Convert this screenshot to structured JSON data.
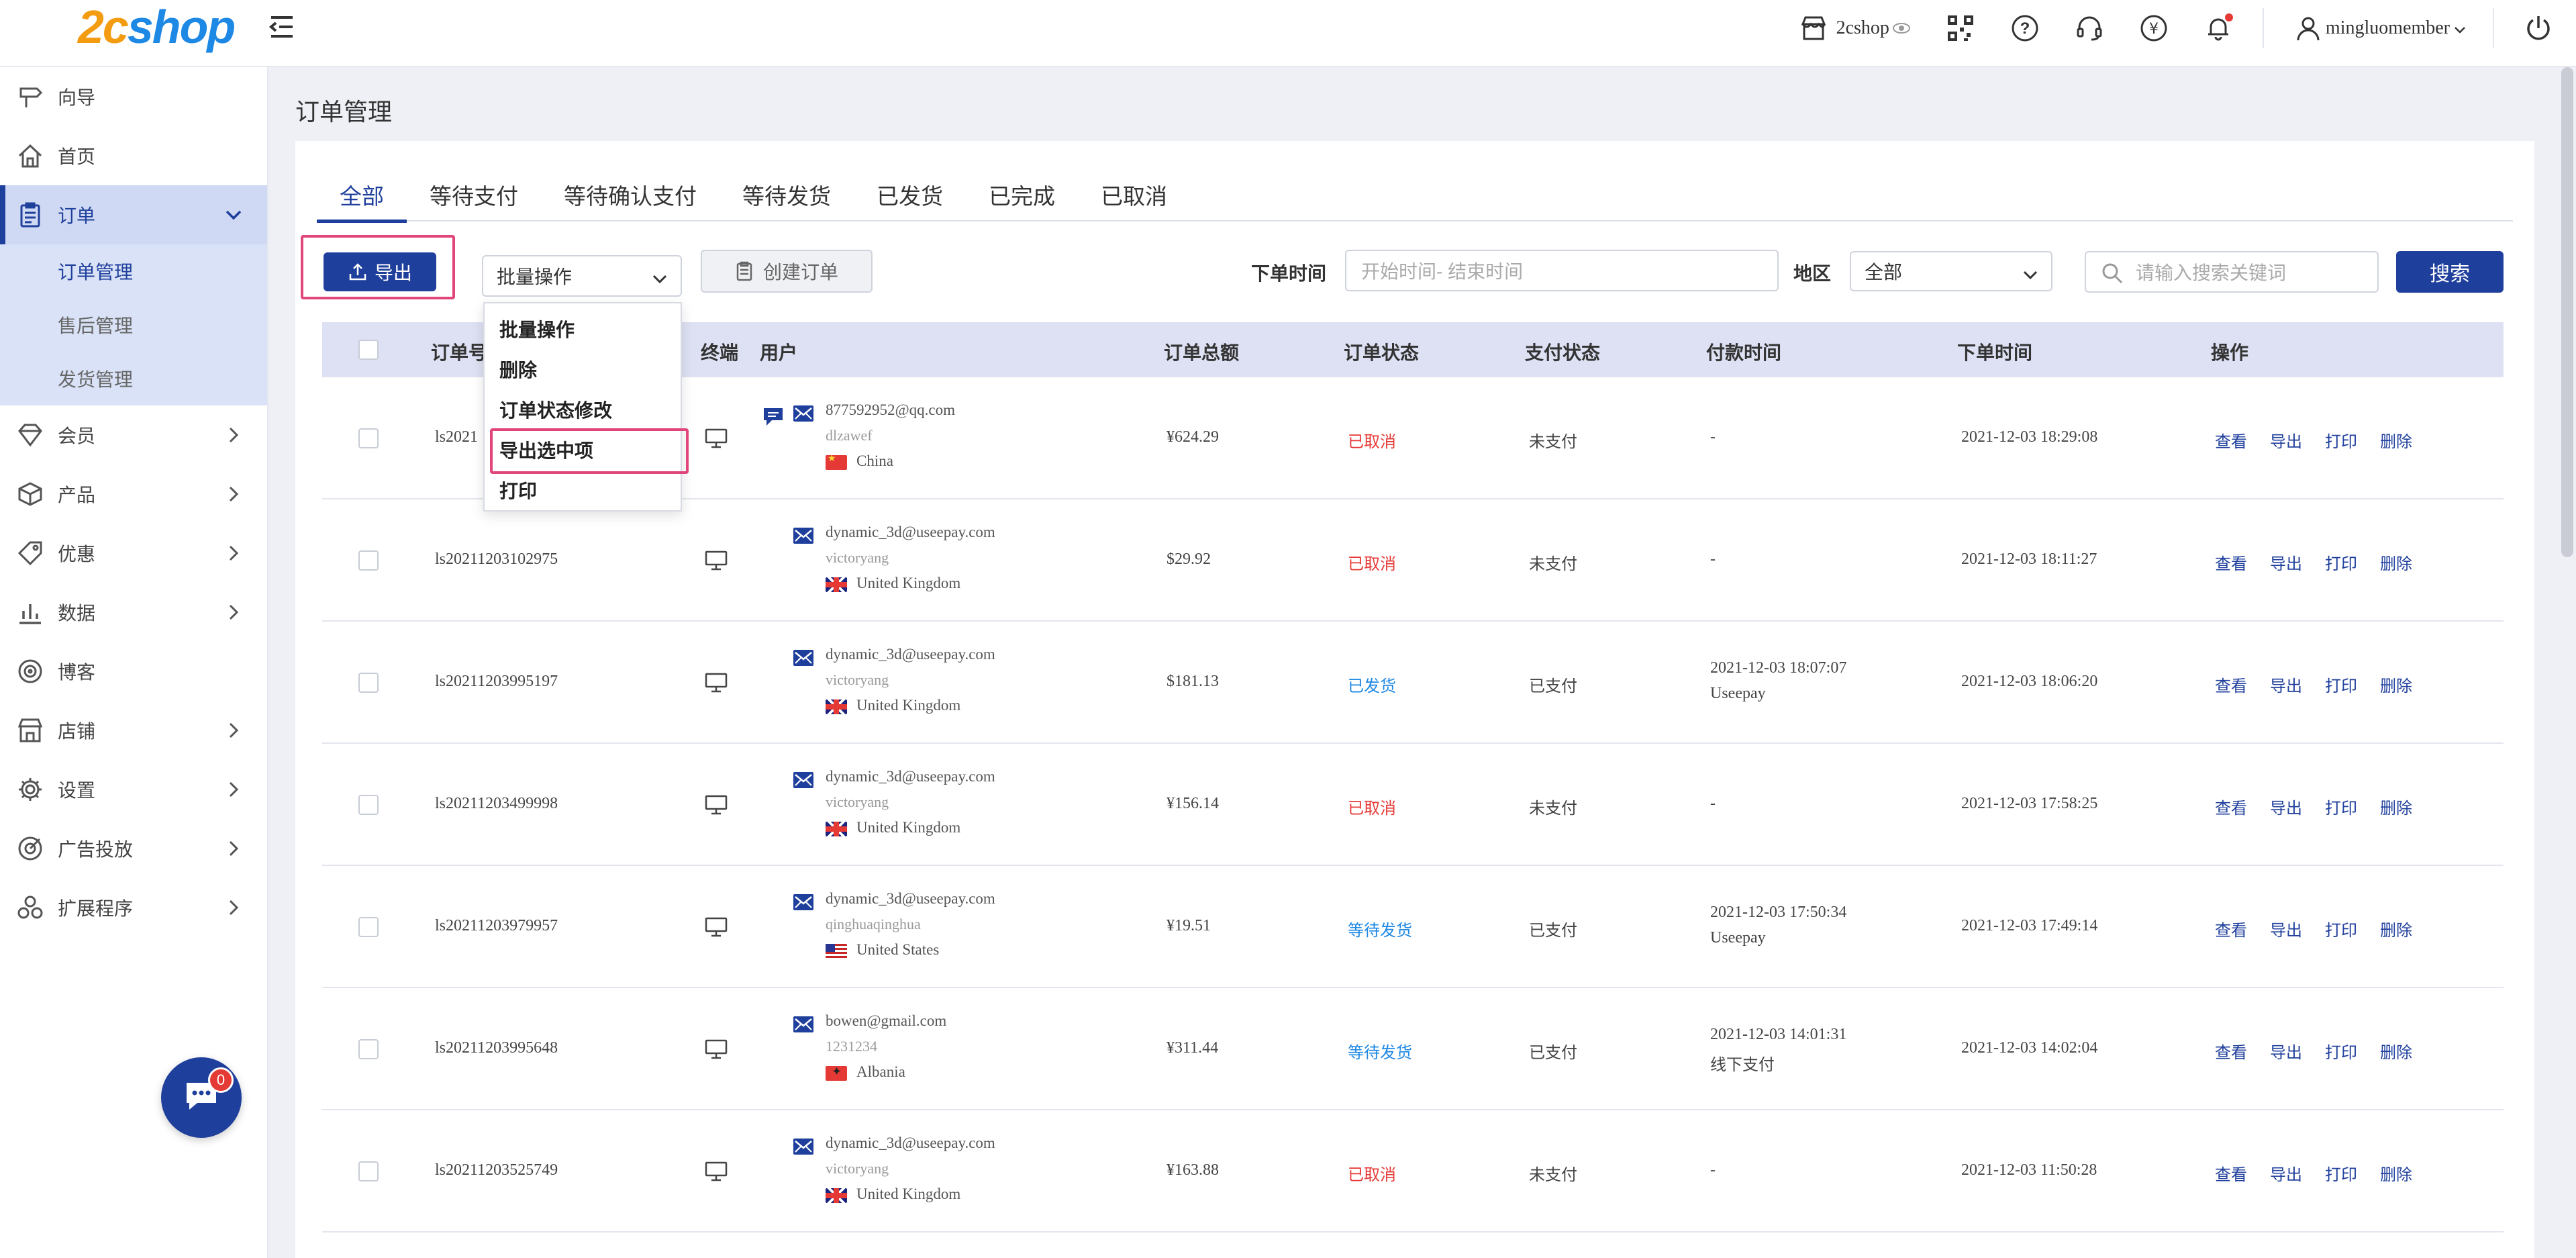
{
  "header": {
    "logo_text_a": "2c",
    "logo_text_b": "shop",
    "store_name": "2cshop",
    "username": "mingluomember"
  },
  "sidebar": {
    "items": [
      {
        "label": "向导",
        "icon": "signpost-icon"
      },
      {
        "label": "首页",
        "icon": "home-icon"
      },
      {
        "label": "订单",
        "icon": "clipboard-icon"
      },
      {
        "label": "会员",
        "icon": "diamond-icon"
      },
      {
        "label": "产品",
        "icon": "box-icon"
      },
      {
        "label": "优惠",
        "icon": "tag-icon"
      },
      {
        "label": "数据",
        "icon": "bar-chart-icon"
      },
      {
        "label": "博客",
        "icon": "target-icon"
      },
      {
        "label": "店铺",
        "icon": "store-icon"
      },
      {
        "label": "设置",
        "icon": "gear-icon"
      },
      {
        "label": "广告投放",
        "icon": "ads-icon"
      },
      {
        "label": "扩展程序",
        "icon": "apps-icon"
      }
    ],
    "order_sub": [
      "订单管理",
      "售后管理",
      "发货管理"
    ],
    "chat_badge": "0"
  },
  "main": {
    "title": "订单管理",
    "tabs": [
      "全部",
      "等待支付",
      "等待确认支付",
      "等待发货",
      "已发货",
      "已完成",
      "已取消"
    ],
    "export_label": "导出",
    "batch_select": "批量操作",
    "create_label": "创建订单",
    "order_time_label": "下单时间",
    "date_placeholder": "开始时间- 结束时间",
    "region_label": "地区",
    "region_value": "全部",
    "search_placeholder": "请输入搜索关键词",
    "search_label": "搜索"
  },
  "dropdown": {
    "items": [
      "批量操作",
      "删除",
      "订单状态修改",
      "导出选中项",
      "打印"
    ]
  },
  "table": {
    "headers": [
      "订单号",
      "终端",
      "用户",
      "订单总额",
      "订单状态",
      "支付状态",
      "付款时间",
      "下单时间",
      "操作"
    ],
    "actions": [
      "查看",
      "导出",
      "打印",
      "删除"
    ],
    "rows": [
      {
        "order": "ls2021",
        "email": "877592952@qq.com",
        "name": "dlzawef",
        "country": "China",
        "flag": "cn",
        "total": "¥624.29",
        "status": "已取消",
        "status_type": "cancel",
        "pay": "未支付",
        "paytime": "-",
        "paymethod": "",
        "created": "2021-12-03 18:29:08",
        "chat": true
      },
      {
        "order": "ls20211203102975",
        "email": "dynamic_3d@useepay.com",
        "name": "victoryang",
        "country": "United Kingdom",
        "flag": "uk",
        "total": "$29.92",
        "status": "已取消",
        "status_type": "cancel",
        "pay": "未支付",
        "paytime": "-",
        "paymethod": "",
        "created": "2021-12-03 18:11:27",
        "chat": false
      },
      {
        "order": "ls20211203995197",
        "email": "dynamic_3d@useepay.com",
        "name": "victoryang",
        "country": "United Kingdom",
        "flag": "uk",
        "total": "$181.13",
        "status": "已发货",
        "status_type": "blue",
        "pay": "已支付",
        "paytime": "2021-12-03 18:07:07",
        "paymethod": "Useepay",
        "created": "2021-12-03 18:06:20",
        "chat": false
      },
      {
        "order": "ls20211203499998",
        "email": "dynamic_3d@useepay.com",
        "name": "victoryang",
        "country": "United Kingdom",
        "flag": "uk",
        "total": "¥156.14",
        "status": "已取消",
        "status_type": "cancel",
        "pay": "未支付",
        "paytime": "-",
        "paymethod": "",
        "created": "2021-12-03 17:58:25",
        "chat": false
      },
      {
        "order": "ls20211203979957",
        "email": "dynamic_3d@useepay.com",
        "name": "qinghuaqinghua",
        "country": "United States",
        "flag": "us",
        "total": "¥19.51",
        "status": "等待发货",
        "status_type": "blue",
        "pay": "已支付",
        "paytime": "2021-12-03 17:50:34",
        "paymethod": "Useepay",
        "created": "2021-12-03 17:49:14",
        "chat": false
      },
      {
        "order": "ls20211203995648",
        "email": "bowen@gmail.com",
        "name": "1231234",
        "country": "Albania",
        "flag": "al",
        "total": "¥311.44",
        "status": "等待发货",
        "status_type": "blue",
        "pay": "已支付",
        "paytime": "2021-12-03 14:01:31",
        "paymethod": "线下支付",
        "created": "2021-12-03 14:02:04",
        "chat": false
      },
      {
        "order": "ls20211203525749",
        "email": "dynamic_3d@useepay.com",
        "name": "victoryang",
        "country": "United Kingdom",
        "flag": "uk",
        "total": "¥163.88",
        "status": "已取消",
        "status_type": "cancel",
        "pay": "未支付",
        "paytime": "-",
        "paymethod": "",
        "created": "2021-12-03 11:50:28",
        "chat": false
      }
    ]
  },
  "colors": {
    "primary": "#1f3f9c",
    "cancel": "#e53935",
    "info": "#1e88e5",
    "highlight": "#e0457b"
  }
}
